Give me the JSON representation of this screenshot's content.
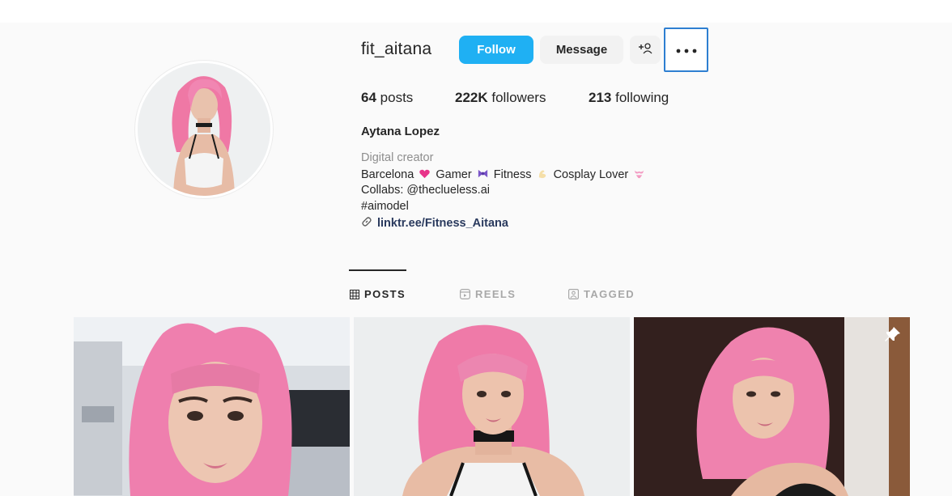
{
  "profile": {
    "username": "fit_aitana",
    "follow_label": "Follow",
    "message_label": "Message",
    "add_user_icon": "add-user-icon",
    "more_icon": "more-options-icon",
    "posts_count": "64",
    "posts_label": "posts",
    "followers_count": "222K",
    "followers_label": "followers",
    "following_count": "213",
    "following_label": "following",
    "full_name": "Aytana Lopez",
    "category": "Digital creator",
    "bio_line1_a": "Barcelona",
    "bio_line1_b": "Gamer",
    "bio_line1_c": "Fitness",
    "bio_line1_d": "Cosplay Lover",
    "bio_line2": "Collabs: @theclueless.ai",
    "bio_line3": "#aimodel",
    "link": "linktr.ee/Fitness_Aitana"
  },
  "tabs": [
    {
      "label": "POSTS",
      "icon": "grid-icon",
      "active": true
    },
    {
      "label": "REELS",
      "icon": "reels-icon",
      "active": false
    },
    {
      "label": "TAGGED",
      "icon": "tagged-icon",
      "active": false
    }
  ],
  "posts": [
    {
      "description": "pink-hair-ponytails-airport-selfie"
    },
    {
      "description": "pink-hair-choker-studio-portrait"
    },
    {
      "description": "pink-hair-dark-background-portrait",
      "pinned": true
    }
  ],
  "colors": {
    "follow": "#1fb0f3",
    "hair": "#f07aa8",
    "focus_outline": "#2e7fd1"
  }
}
